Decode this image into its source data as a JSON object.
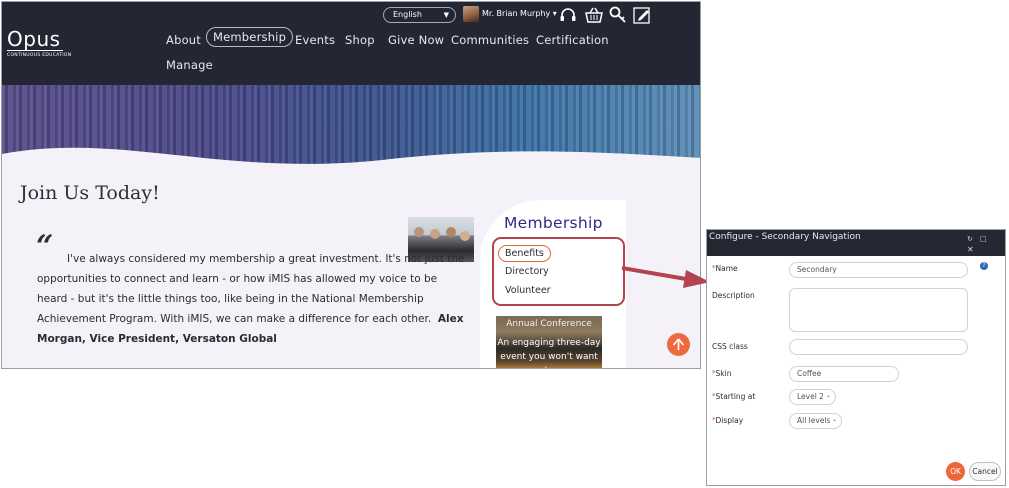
{
  "site": {
    "logo": {
      "word": "Opus",
      "subtitle": "CONTINUOUS EDUCATION"
    },
    "language": {
      "selected": "English"
    },
    "user": {
      "name": "Mr. Brian Murphy ▾"
    },
    "utility_icons": [
      "headset-icon",
      "basket-icon",
      "key-search-icon",
      "edit-icon"
    ],
    "nav": [
      "About",
      "Membership",
      "Events",
      "Shop",
      "Give Now",
      "Communities",
      "Certification",
      "Manage"
    ],
    "nav_active": "Membership",
    "page_title": "Join Us Today!",
    "quote_mark": "“",
    "quote": "I've always considered my membership a great investment. It's not just the opportunities to connect and learn - or how iMIS has allowed my voice to be heard - but it's the little things too, like being in the National Membership Achievement Program. With iMIS, we can make a difference for each other.",
    "quote_author": "Alex Morgan, Vice President, Versaton Global",
    "side_title": "Membership",
    "secondary_nav": [
      "Benefits",
      "Directory",
      "Volunteer"
    ],
    "secondary_selected": "Benefits",
    "banner": {
      "title": "Annual Conference",
      "text": "An engaging three-day event you won't want to"
    },
    "colors": {
      "header": "#242733",
      "accent": "#ee6a3e",
      "callout": "#b2434f",
      "membership_title": "#2d2a86"
    }
  },
  "dialog": {
    "title": "Configure - Secondary Navigation",
    "icons": [
      "refresh-icon",
      "maximize-icon",
      "close-icon"
    ],
    "fields": {
      "name": {
        "label": "Name",
        "required": true,
        "value": "Secondary"
      },
      "description": {
        "label": "Description",
        "required": false,
        "value": ""
      },
      "css_class": {
        "label": "CSS class",
        "required": false,
        "value": ""
      },
      "skin": {
        "label": "Skin",
        "required": true,
        "value": "Coffee"
      },
      "starting_at": {
        "label": "Starting at",
        "required": true,
        "value": "Level 2"
      },
      "display": {
        "label": "Display",
        "required": true,
        "value": "All levels"
      }
    },
    "required_marker": "*",
    "help": "?",
    "ok_label": "OK",
    "cancel_label": "Cancel"
  }
}
